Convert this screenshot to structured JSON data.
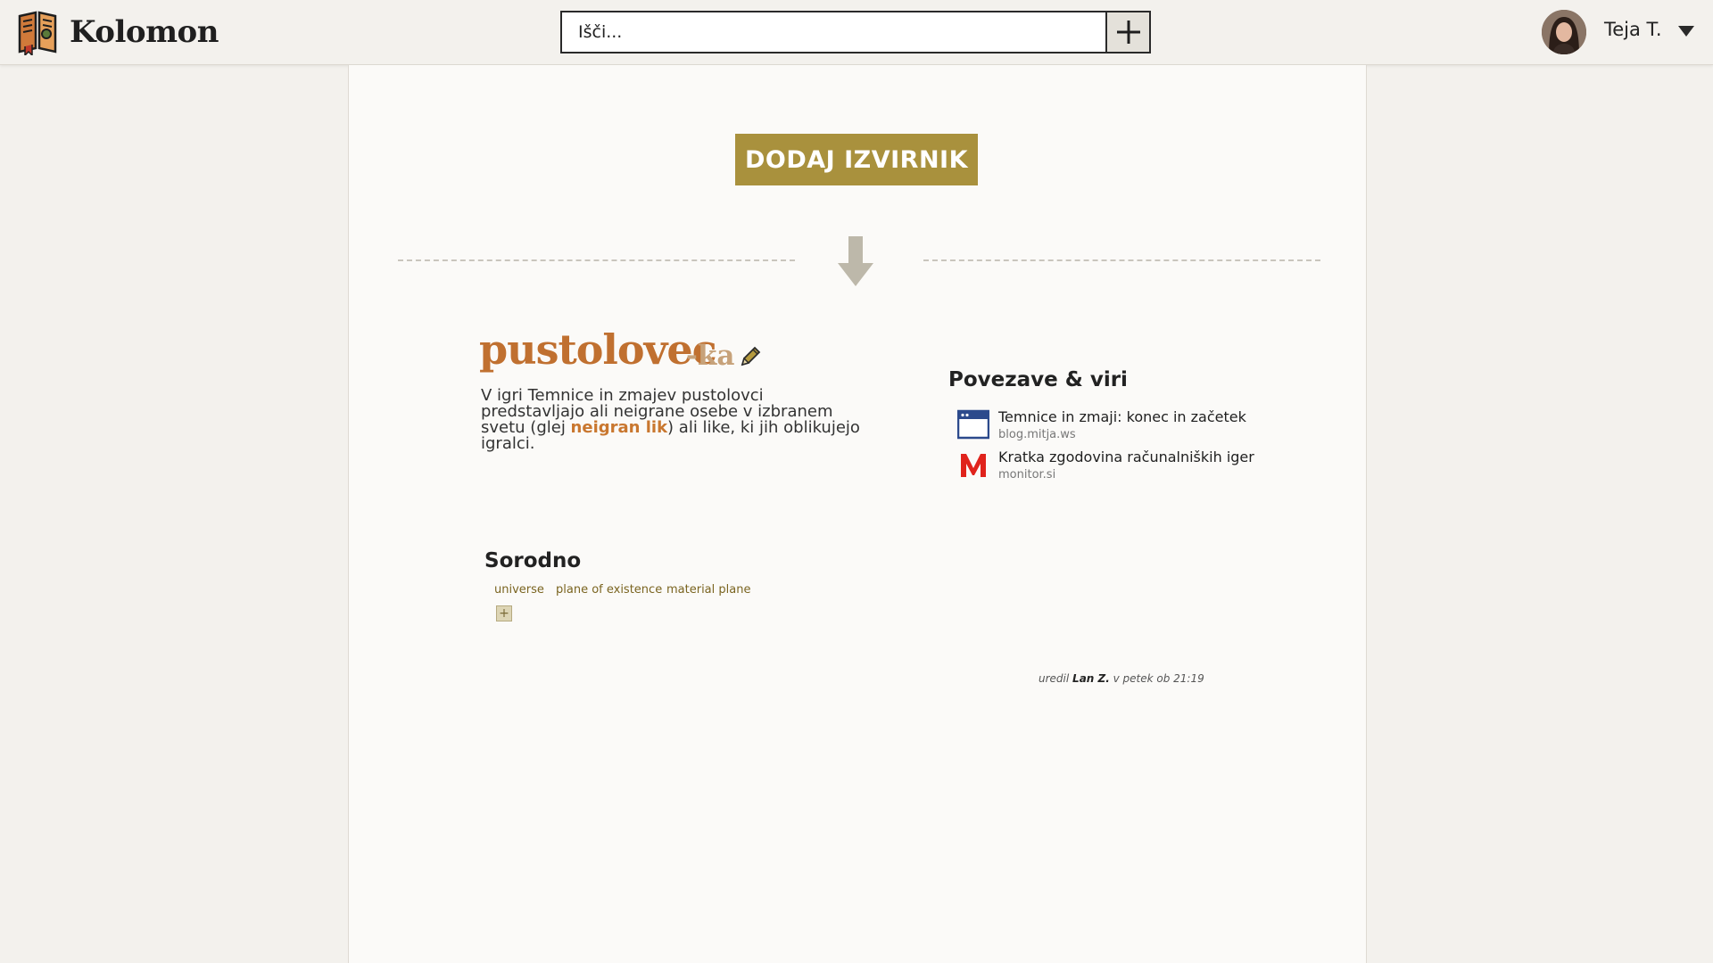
{
  "header": {
    "brand": "Kolomon",
    "search_placeholder": "Išči...",
    "user_name": "Teja T."
  },
  "main": {
    "add_source_label": "DODAJ IZVIRNIK",
    "entry": {
      "headword": "pustolovec",
      "suffix": "-ka",
      "definition_before": " V igri Temnice in zmajev pustolovci predstavljajo ali neigrane osebe v izbranem svetu (glej ",
      "definition_link": "neigran lik",
      "definition_after": ") ali like, ki jih oblikujejo igralci."
    },
    "links": {
      "title": "Povezave & viri",
      "items": [
        {
          "title": "Temnice in zmaji: konec in začetek",
          "domain": "blog.mitja.ws",
          "icon": "browser-window-icon"
        },
        {
          "title": "Kratka zgodovina računalniških iger",
          "domain": "monitor.si",
          "icon": "monitor-m-logo-icon"
        }
      ]
    },
    "related": {
      "title": "Sorodno",
      "tags": [
        "universe",
        "plane of existence",
        "material plane"
      ],
      "add_label": "+"
    },
    "edit": {
      "prefix": "uredil",
      "user": "Lan Z.",
      "when": "v petek ob 21:19"
    }
  },
  "colors": {
    "accent": "#a9913d",
    "headword": "#c07030",
    "link": "#c9772f",
    "background": "#f3f1ed",
    "panel": "#fbfaf8"
  }
}
